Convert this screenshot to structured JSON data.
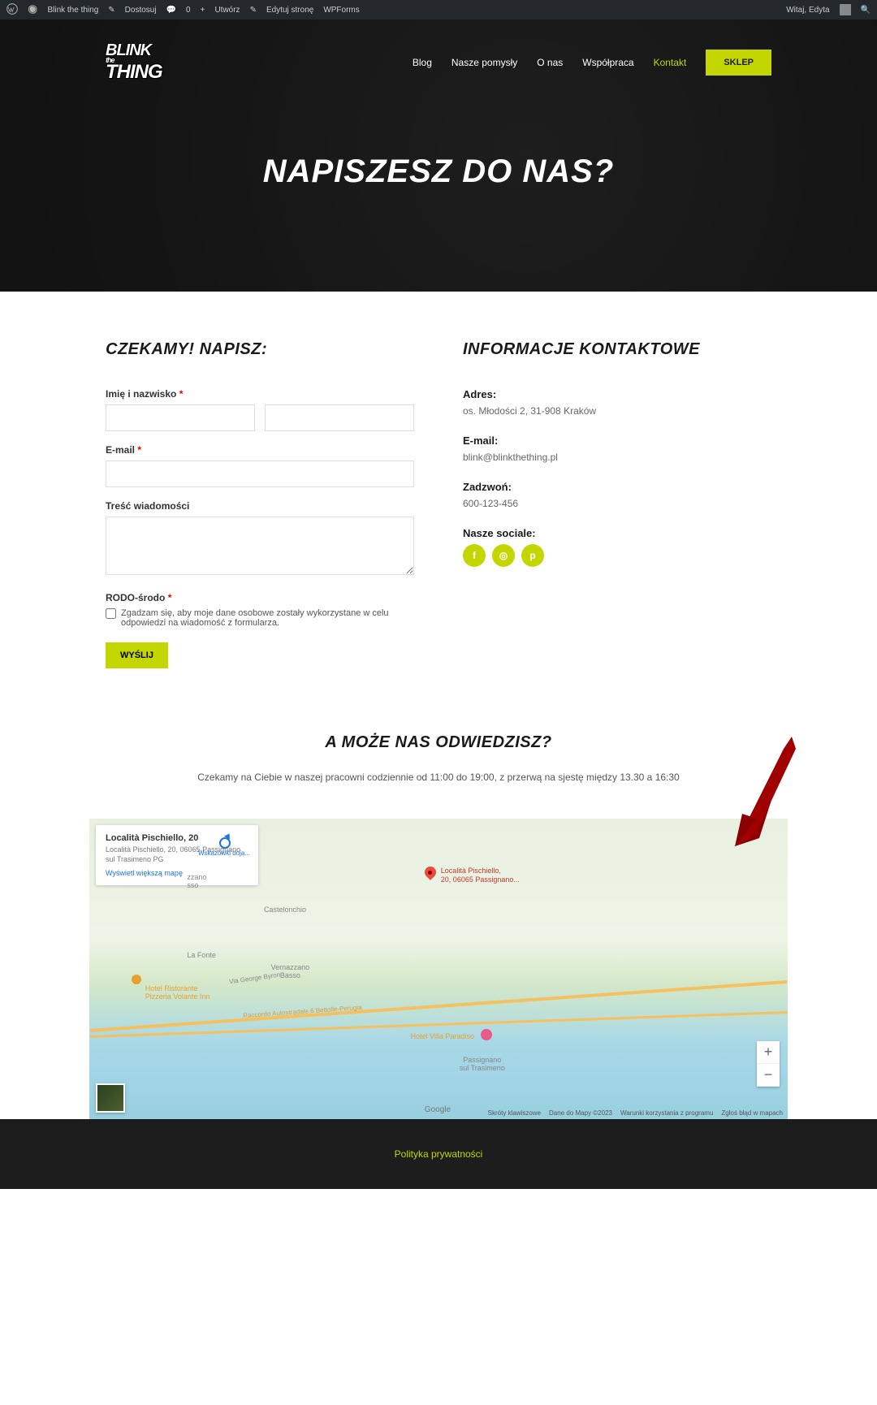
{
  "admin": {
    "site": "Blink the thing",
    "customize": "Dostosuj",
    "comments": "0",
    "new": "Utwórz",
    "edit": "Edytuj stronę",
    "wpforms": "WPForms",
    "greeting": "Witaj, Edyta"
  },
  "nav": {
    "logo_line1": "BLINK",
    "logo_line2": "THING",
    "logo_the": "the",
    "items": [
      {
        "label": "Blog",
        "active": false
      },
      {
        "label": "Nasze pomysły",
        "active": false
      },
      {
        "label": "O nas",
        "active": false
      },
      {
        "label": "Współpraca",
        "active": false
      },
      {
        "label": "Kontakt",
        "active": true
      }
    ],
    "shop": "SKLEP"
  },
  "hero": {
    "title": "NAPISZESZ DO NAS?"
  },
  "form": {
    "heading": "CZEKAMY! NAPISZ:",
    "name_label": "Imię i nazwisko",
    "email_label": "E-mail",
    "message_label": "Treść wiadomości",
    "rodo_label": "RODO-środo",
    "rodo_text": "Zgadzam się, aby moje dane osobowe zostały wykorzystane w celu odpowiedzi na wiadomość z formularza.",
    "submit": "WYŚLIJ"
  },
  "info": {
    "heading": "INFORMACJE KONTAKTOWE",
    "address_label": "Adres:",
    "address": "os. Młodości 2, 31-908 Kraków",
    "email_label": "E-mail:",
    "email": "blink@blinkthething.pl",
    "phone_label": "Zadzwoń:",
    "phone": "600-123-456",
    "social_label": "Nasze sociale:"
  },
  "visit": {
    "heading": "A MOŻE NAS ODWIEDZISZ?",
    "sub": "Czekamy na Ciebie w naszej pracowni codziennie od 11:00 do 19:00, z przerwą na sjestę między 13.30 a 16:30"
  },
  "map": {
    "card_title": "Località Pischiello, 20",
    "card_addr": "Località Pischiello, 20, 06065 Passignano sul Trasimeno PG",
    "card_larger": "Wyświetl większą mapę",
    "card_dir": "Wskazówki doja...",
    "pin_label1": "Località Pischiello,",
    "pin_label2": "20, 06065 Passignano...",
    "labels": {
      "zzano": "zzano\nsso",
      "castelonchio": "Castelonchio",
      "vernazzano": "Vernazzano\nBasso",
      "lafonte": "La Fonte",
      "hotel1": "Hotel Ristorante\nPizzeria Volante Inn",
      "hotel2": "Hotel Villa Paradiso",
      "passignano": "Passignano\nsul Trasimeno",
      "road": "Via George Byron",
      "raccordo": "Raccordo Autostradale 6 Bettolle-Perugia"
    },
    "google": "Google",
    "footer": {
      "shortcuts": "Skróty klawiszowe",
      "data": "Dane do Mapy ©2023",
      "terms": "Warunki korzystania z programu",
      "report": "Zgłoś błąd w mapach"
    }
  },
  "footer": {
    "privacy": "Polityka prywatności"
  }
}
